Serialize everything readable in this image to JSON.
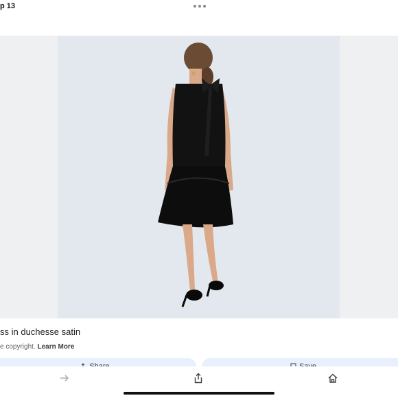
{
  "status_bar": {
    "time": "p 13"
  },
  "caption": {
    "title": "ss in duchesse satin",
    "subtitle_prefix": "e copyright.",
    "learn_more": "Learn More"
  },
  "actions": {
    "share_label": "Share",
    "save_label": "Save"
  },
  "nav": {
    "icons": [
      "forward-arrow-icon",
      "share-icon",
      "home-icon"
    ]
  },
  "colors": {
    "button_bg": "#e8f0fe",
    "image_bg": "#e3e8ee",
    "dress": "#121212"
  }
}
